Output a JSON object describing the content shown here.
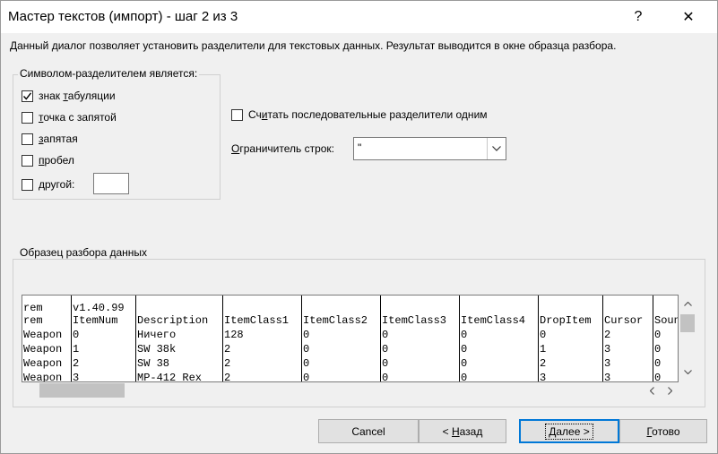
{
  "window": {
    "title": "Мастер текстов (импорт) - шаг 2 из 3",
    "help_glyph": "?",
    "close_glyph": "✕"
  },
  "description": "Данный диалог позволяет установить разделители для текстовых данных. Результат выводится в окне образца разбора.",
  "delimiters": {
    "legend": "Символом-разделителем является:",
    "items": [
      {
        "label_pre": "знак ",
        "label_u": "т",
        "label_post": "абуляции",
        "checked": true
      },
      {
        "label_pre": "",
        "label_u": "т",
        "label_post": "очка с запятой",
        "checked": false
      },
      {
        "label_pre": "",
        "label_u": "з",
        "label_post": "апятая",
        "checked": false
      },
      {
        "label_pre": "",
        "label_u": "п",
        "label_post": "робел",
        "checked": false
      },
      {
        "label_pre": "",
        "label_u": "д",
        "label_post": "ругой:",
        "checked": false
      }
    ],
    "other_value": ""
  },
  "consecutive": {
    "label_pre": "Сч",
    "label_u": "и",
    "label_post": "тать последовательные разделители одним",
    "checked": false
  },
  "qualifier": {
    "label_pre": "",
    "label_u": "О",
    "label_post": "граничитель строк:",
    "value": "\""
  },
  "preview": {
    "legend": "Образец разбора данных",
    "columns": [
      [
        "rem",
        "rem",
        "Weapon",
        "Weapon",
        "Weapon",
        "Weapon"
      ],
      [
        "v1.40.99",
        "ItemNum",
        "0",
        "1",
        "2",
        "3"
      ],
      [
        "",
        "Description",
        "Ничего",
        "SW 38k",
        "SW 38",
        "MP-412 Rex"
      ],
      [
        "",
        "ItemClass1",
        "128",
        "2",
        "2",
        "2"
      ],
      [
        "",
        "ItemClass2",
        "0",
        "0",
        "0",
        "0"
      ],
      [
        "",
        "ItemClass3",
        "0",
        "0",
        "0",
        "0"
      ],
      [
        "",
        "ItemClass4",
        "0",
        "0",
        "0",
        "0"
      ],
      [
        "",
        "DropItem",
        "0",
        "1",
        "2",
        "3"
      ],
      [
        "",
        "Cursor",
        "2",
        "3",
        "3",
        "3"
      ],
      [
        "",
        "Sound",
        "0",
        "0",
        "0",
        "0"
      ]
    ]
  },
  "buttons": {
    "cancel": "Cancel",
    "back_pre": "< ",
    "back_u": "Н",
    "back_post": "азад",
    "next_pre": "",
    "next_u": "Д",
    "next_post": "алее >",
    "finish_pre": "",
    "finish_u": "Г",
    "finish_post": "отово"
  }
}
